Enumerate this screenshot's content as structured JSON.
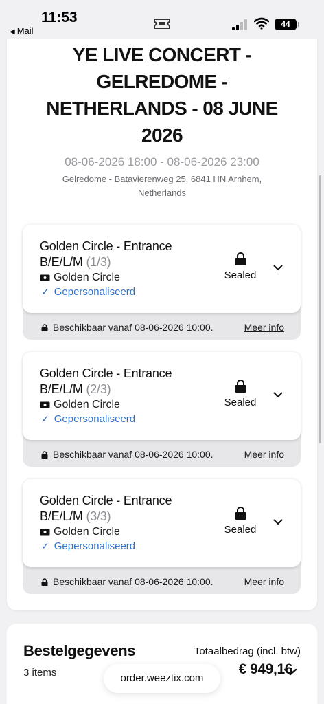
{
  "status_bar": {
    "time": "11:53",
    "back_app": "Mail",
    "battery": "44"
  },
  "event": {
    "title": "YE LIVE CONCERT - GELREDOME - NETHERLANDS - 08 JUNE 2026",
    "datetime": "08-06-2026 18:00 - 08-06-2026 23:00",
    "venue": "Gelredome - Batavierenweg 25, 6841 HN Arnhem, Netherlands"
  },
  "tickets": [
    {
      "title": "Golden Circle - Entrance B/E/L/M",
      "count": "(1/3)",
      "type": "Golden Circle",
      "personalized": "Gepersonaliseerd",
      "status": "Sealed",
      "availability": "Beschikbaar vanaf 08-06-2026 10:00.",
      "more_info": "Meer info"
    },
    {
      "title": "Golden Circle - Entrance B/E/L/M",
      "count": "(2/3)",
      "type": "Golden Circle",
      "personalized": "Gepersonaliseerd",
      "status": "Sealed",
      "availability": "Beschikbaar vanaf 08-06-2026 10:00.",
      "more_info": "Meer info"
    },
    {
      "title": "Golden Circle - Entrance B/E/L/M",
      "count": "(3/3)",
      "type": "Golden Circle",
      "personalized": "Gepersonaliseerd",
      "status": "Sealed",
      "availability": "Beschikbaar vanaf 08-06-2026 10:00.",
      "more_info": "Meer info"
    }
  ],
  "order": {
    "title": "Bestelgegevens",
    "items": "3 items",
    "total_label": "Totaalbedrag (incl. btw)",
    "total_amount": "€ 949,16"
  },
  "browser": {
    "url": "order.weeztix.com"
  },
  "colors": {
    "accent_blue": "#2f72c8",
    "muted_gray": "#9c9ca1",
    "footer_gray": "#e7e7e9"
  }
}
